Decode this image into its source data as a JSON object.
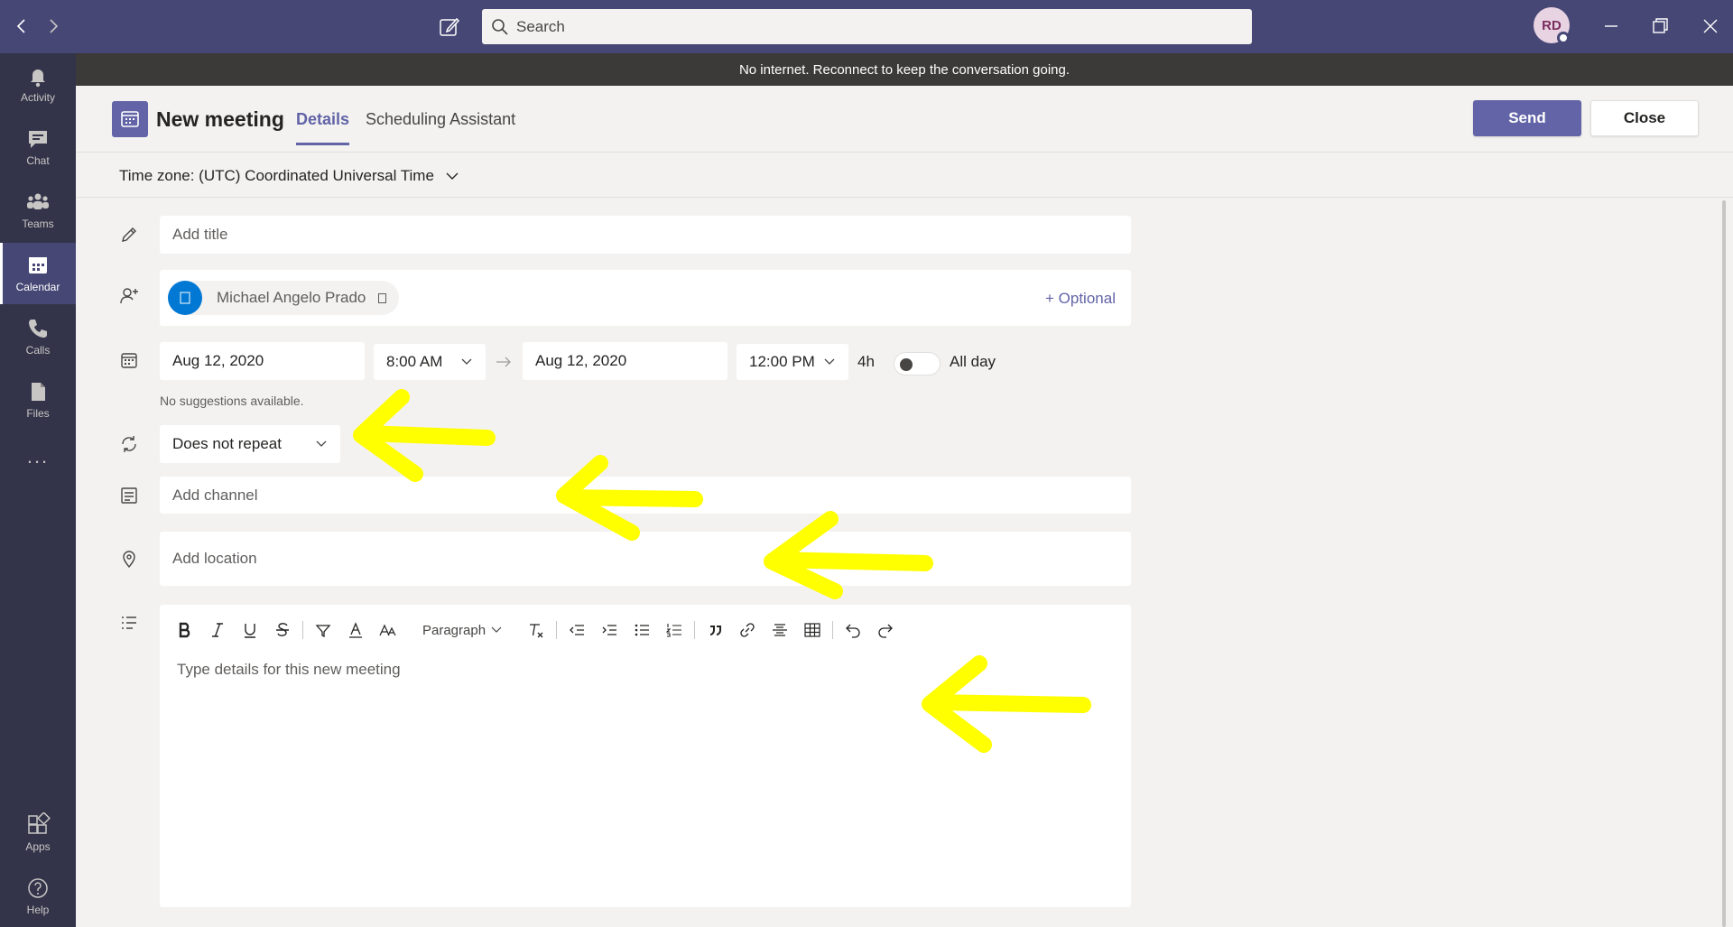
{
  "titlebar": {
    "search_placeholder": "Search",
    "avatar_initials": "RD",
    "colors": {
      "bar": "#464775",
      "rail": "#33344a",
      "accent": "#6264a7"
    }
  },
  "rail": {
    "items": [
      {
        "label": "Activity",
        "icon": "bell-icon"
      },
      {
        "label": "Chat",
        "icon": "chat-icon"
      },
      {
        "label": "Teams",
        "icon": "teams-icon"
      },
      {
        "label": "Calendar",
        "icon": "calendar-icon",
        "active": true
      },
      {
        "label": "Calls",
        "icon": "phone-icon"
      },
      {
        "label": "Files",
        "icon": "files-icon"
      }
    ],
    "more_label": "...",
    "bottom": [
      {
        "label": "Apps",
        "icon": "apps-icon"
      },
      {
        "label": "Help",
        "icon": "help-icon"
      }
    ]
  },
  "banner": {
    "text": "No internet. Reconnect to keep the conversation going."
  },
  "meeting": {
    "title": "New meeting",
    "tabs": [
      {
        "label": "Details",
        "active": true
      },
      {
        "label": "Scheduling Assistant"
      }
    ],
    "send_label": "Send",
    "close_label": "Close"
  },
  "timezone": {
    "label": "Time zone: (UTC) Coordinated Universal Time"
  },
  "form": {
    "title_placeholder": "Add title",
    "attendee": {
      "name": "Michael Angelo Prado"
    },
    "optional_label": "+ Optional",
    "start_date": "Aug 12, 2020",
    "start_time": "8:00 AM",
    "end_date": "Aug 12, 2020",
    "end_time": "12:00 PM",
    "duration": "4h",
    "all_day_label": "All day",
    "all_day": false,
    "suggestions": "No suggestions available.",
    "repeat": "Does not repeat",
    "channel_placeholder": "Add channel",
    "location_placeholder": "Add location",
    "details_placeholder": "Type details for this new meeting"
  },
  "editor": {
    "paragraph_label": "Paragraph",
    "toolbar": [
      "bold-icon",
      "italic-icon",
      "underline-icon",
      "strikethrough-icon",
      "highlight-icon",
      "font-color-icon",
      "font-size-icon",
      "paragraph-dropdown",
      "clear-format-icon",
      "decrease-indent-icon",
      "increase-indent-icon",
      "bulleted-list-icon",
      "numbered-list-icon",
      "quote-icon",
      "link-icon",
      "horizontal-rule-icon",
      "table-icon",
      "undo-icon",
      "redo-icon"
    ]
  }
}
